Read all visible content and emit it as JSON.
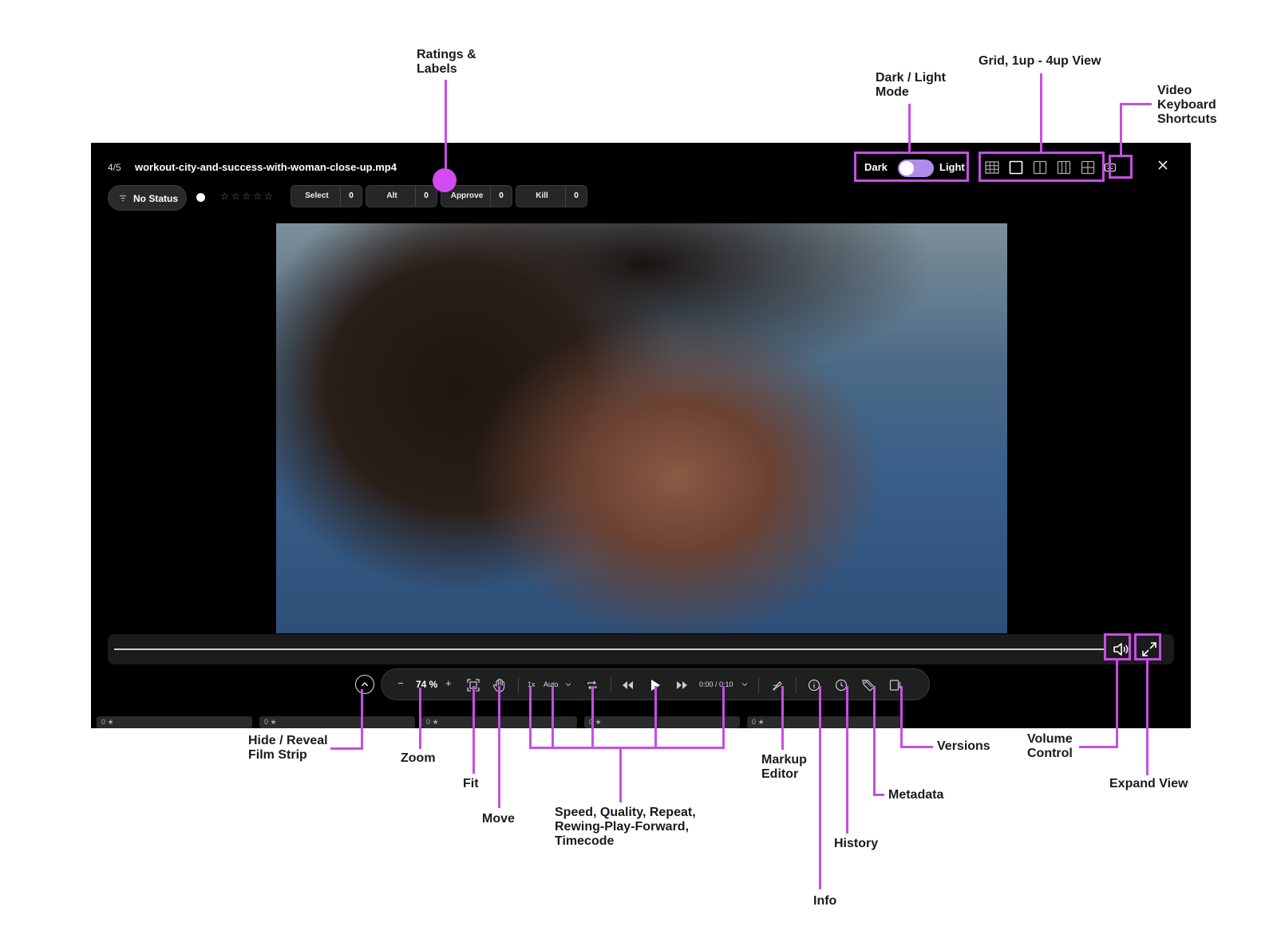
{
  "app": {
    "counter": "4/5",
    "filename": "workout-city-and-success-with-woman-close-up.mp4",
    "theme": {
      "dark_label": "Dark",
      "light_label": "Light"
    },
    "view_modes": [
      "grid-icon",
      "1up-icon",
      "2up-icon",
      "3up-icon",
      "4up-icon"
    ],
    "status": {
      "label": "No Status"
    },
    "rating": {
      "stars": "☆☆☆☆☆"
    },
    "labels": [
      {
        "name": "Select",
        "count": "0"
      },
      {
        "name": "Alt",
        "count": "0"
      },
      {
        "name": "Approve",
        "count": "0"
      },
      {
        "name": "Kill",
        "count": "0"
      }
    ],
    "controls": {
      "zoom_minus": "−",
      "zoom_value": "74 %",
      "zoom_plus": "+",
      "speed": "1x",
      "quality": "Auto",
      "timecode": "0:00 / 0:10"
    },
    "film_strip": [
      "0 ★",
      "0 ★",
      "0 ★",
      "0 ★",
      "0 ★"
    ]
  },
  "annotations": {
    "ratings_labels": "Ratings &\nLabels",
    "dark_light": "Dark / Light\nMode",
    "grid_view": "Grid, 1up - 4up View",
    "keyboard": "Video\nKeyboard\nShortcuts",
    "film_strip": "Hide / Reveal\nFilm Strip",
    "zoom": "Zoom",
    "fit": "Fit",
    "move": "Move",
    "speed_group": "Speed, Quality, Repeat,\nRewing-Play-Forward,\nTimecode",
    "markup": "Markup\nEditor",
    "info": "Info",
    "history": "History",
    "metadata": "Metadata",
    "versions": "Versions",
    "volume": "Volume\nControl",
    "expand": "Expand View"
  },
  "colors": {
    "accent": "#c64ee6",
    "toggle": "#b08ce8",
    "window_bg": "#000000"
  }
}
